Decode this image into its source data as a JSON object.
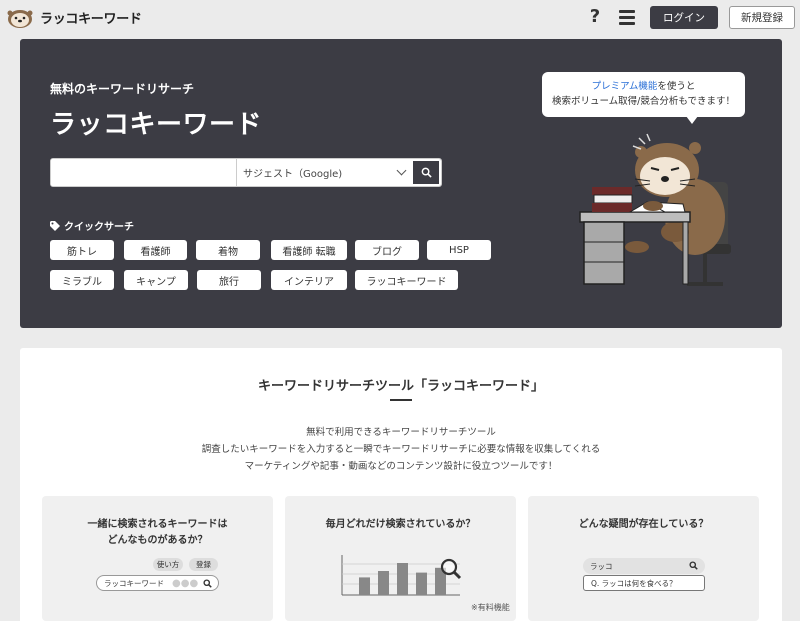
{
  "header": {
    "logo_text": "ラッコキーワード",
    "login_label": "ログイン",
    "register_label": "新規登録"
  },
  "hero": {
    "subtitle": "無料のキーワードリサーチ",
    "title": "ラッコキーワード",
    "search_placeholder": "",
    "select_value": "サジェスト（Google)",
    "quick_label": "クイックサーチ",
    "chips": [
      "筋トレ",
      "看護師",
      "着物",
      "看護師 転職",
      "ブログ",
      "HSP",
      "ミラブル",
      "キャンプ",
      "旅行",
      "インテリア",
      "ラッコキーワード"
    ],
    "bubble_link": "プレミアム機能",
    "bubble_line1_rest": "を使うと",
    "bubble_line2": "検索ボリューム取得/競合分析もできます！"
  },
  "main": {
    "title": "キーワードリサーチツール「ラッコキーワード」",
    "desc": [
      "無料で利用できるキーワードリサーチツール",
      "調査したいキーワードを入力すると一瞬でキーワードリサーチに必要な情報を収集してくれる",
      "マーケティングや記事・動画などのコンテンツ設計に役立つツールです！"
    ],
    "cards": [
      {
        "title_line1": "一緒に検索されるキーワードは",
        "title_line2": "どんなものがあるか？",
        "pill1": "使い方",
        "pill2": "登録",
        "search_text": "ラッコキーワード"
      },
      {
        "title": "毎月どれだけ検索されているか？",
        "bars": [
          0.55,
          0.75,
          1.0,
          0.7,
          0.85
        ],
        "note": "※有料機能"
      },
      {
        "title": "どんな疑問が存在している？",
        "search_text": "ラッコ",
        "suggest_text": "Q. ラッコは何を食べる？"
      }
    ]
  },
  "colors": {
    "hero_bg": "#3c3c44",
    "page_bg": "#ebebeb",
    "link": "#2a6fd6"
  }
}
